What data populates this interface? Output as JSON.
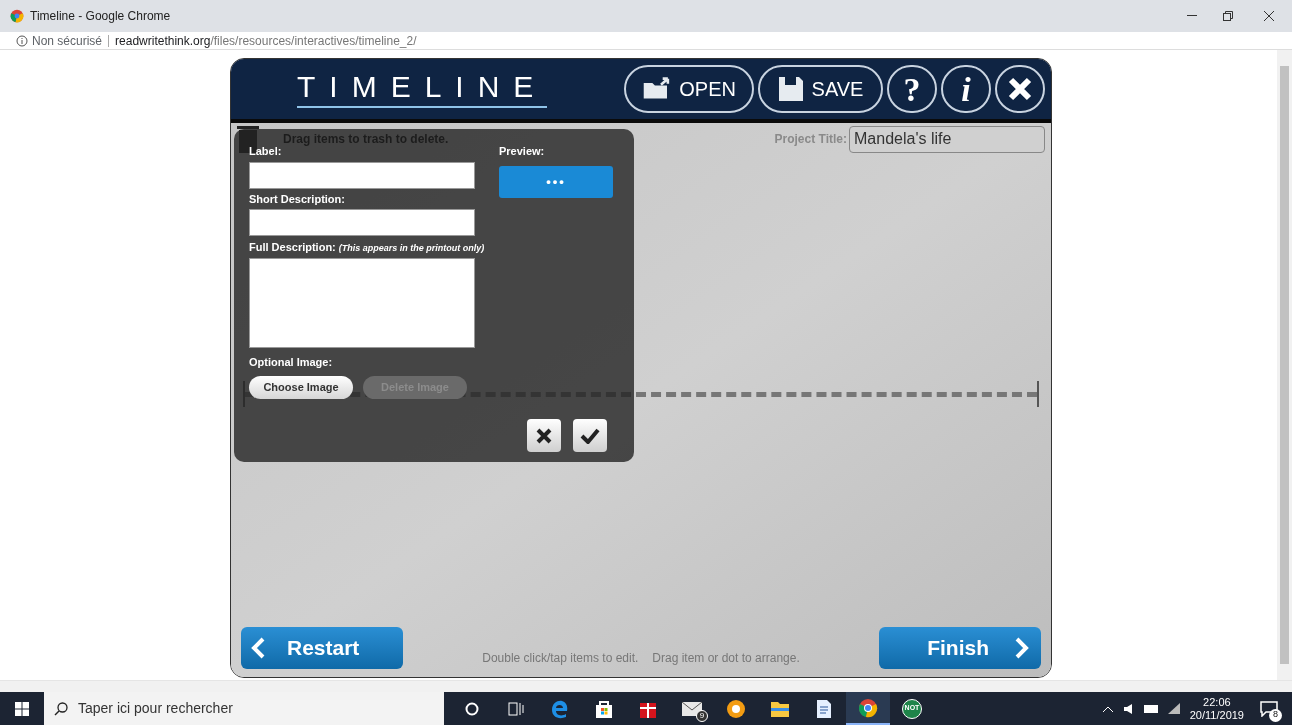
{
  "browser": {
    "title": "Timeline - Google Chrome",
    "security": "Non sécurisé",
    "url_host": "readwritethink.org",
    "url_path": "/files/resources/interactives/timeline_2/"
  },
  "app": {
    "logo": "TIMELINE",
    "header_buttons": [
      {
        "kind": "open",
        "label": "OPEN"
      },
      {
        "kind": "save",
        "label": "SAVE"
      },
      {
        "kind": "help",
        "label": "?"
      },
      {
        "kind": "info",
        "label": "i"
      },
      {
        "kind": "close"
      }
    ],
    "trash_hint": "Drag items to trash to delete.",
    "project_title": {
      "label": "Project Title:",
      "value": "Mandela's life"
    },
    "dialog": {
      "label_label": "Label:",
      "short_label": "Short Description:",
      "full_label": "Full Description:",
      "full_note": "(This appears in the printout only)",
      "preview_label": "Preview:",
      "preview_text": "•••",
      "image_label": "Optional Image:",
      "image_buttons": [
        {
          "label": "Choose Image",
          "disabled": false
        },
        {
          "label": "Delete Image",
          "disabled": true
        }
      ]
    },
    "restart": "Restart",
    "finish": "Finish",
    "footer_hints": [
      "Double click/tap items to edit.",
      "Drag item or dot to arrange."
    ]
  },
  "taskbar": {
    "search_placeholder": "Taper ici pour rechercher",
    "apps": [
      {
        "kind": "cortana",
        "selected": false
      },
      {
        "kind": "taskview",
        "selected": false
      },
      {
        "kind": "edge",
        "selected": false
      },
      {
        "kind": "store",
        "selected": false
      },
      {
        "kind": "gift",
        "selected": false
      },
      {
        "kind": "mail",
        "badge": "9",
        "selected": false
      },
      {
        "kind": "orange",
        "selected": false
      },
      {
        "kind": "folder",
        "selected": false
      },
      {
        "kind": "doc",
        "selected": false
      },
      {
        "kind": "chrome",
        "selected": true
      },
      {
        "kind": "not",
        "text": "NOT",
        "selected": false
      }
    ],
    "time": "22:06",
    "date": "20/11/2019",
    "notifications": "8"
  }
}
